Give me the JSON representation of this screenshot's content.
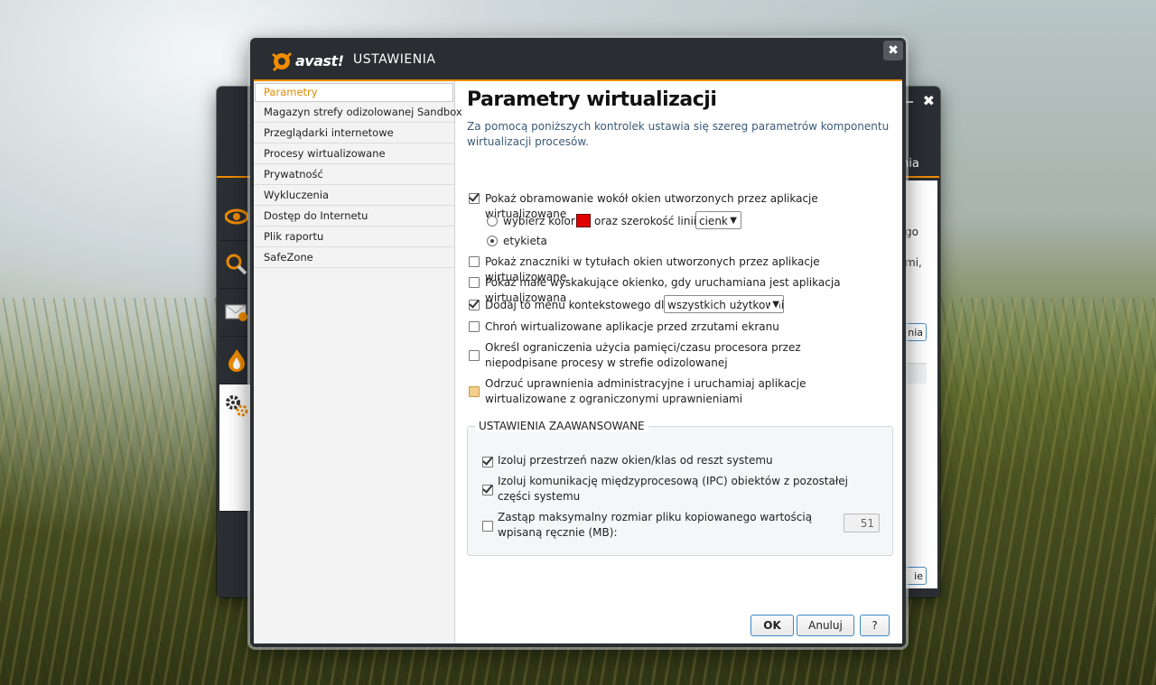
{
  "dialog": {
    "brand": "avast!",
    "title": "USTAWIENIA",
    "close_glyph": "✖"
  },
  "sidebar": {
    "items": [
      {
        "label": "Parametry",
        "active": true
      },
      {
        "label": "Magazyn strefy odizolowanej Sandbox"
      },
      {
        "label": "Przeglądarki internetowe"
      },
      {
        "label": "Procesy wirtualizowane"
      },
      {
        "label": "Prywatność"
      },
      {
        "label": "Wykluczenia"
      },
      {
        "label": "Dostęp do Internetu"
      },
      {
        "label": "Plik raportu"
      },
      {
        "label": "SafeZone"
      }
    ]
  },
  "main": {
    "title": "Parametry wirtualizacji",
    "description": "Za pomocą poniższych kontrolek ustawia się szereg parametrów komponentu wirtualizacji procesów.",
    "options": {
      "show_border": {
        "label": "Pokaż obramowanie wokół okien utworzonych przez aplikacje wirtualizowane",
        "checked": true
      },
      "choose_color": {
        "label": "wybierz kolor",
        "checked": false
      },
      "line_width_label": "oraz szerokość linii",
      "line_width_value": "cienk",
      "label_option": {
        "label": "etykieta",
        "checked": true
      },
      "title_markers": {
        "label": "Pokaż znaczniki w tytułach okien utworzonych przez aplikacje wirtualizowane",
        "checked": false
      },
      "popup": {
        "label": "Pokaż małe wyskakujące okienko, gdy uruchamiana jest aplikacja wirtualizowana",
        "checked": false
      },
      "context_menu": {
        "label": "Dodaj to menu kontekstowego dla:",
        "checked": true
      },
      "context_menu_value": "wszystkich użytkowni",
      "screenshots": {
        "label": "Chroń wirtualizowane aplikacje przed zrzutami ekranu",
        "checked": false
      },
      "limits": {
        "label": "Określ ograniczenia użycia pamięci/czasu procesora przez niepodpisane procesy w strefie odizolowanej",
        "checked": false
      },
      "drop_admin": {
        "label": "Odrzuć uprawnienia administracyjne i uruchamiaj aplikacje wirtualizowane z ograniczonymi uprawnieniami",
        "checked": "partial"
      }
    },
    "color_swatch": "#e00000",
    "advanced": {
      "legend": "USTAWIENIA ZAAWANSOWANE",
      "isolate_namespace": {
        "label": "Izoluj przestrzeń nazw okien/klas od reszt systemu",
        "checked": true
      },
      "isolate_ipc": {
        "label": "Izoluj komunikację międzyprocesową (IPC) obiektów z pozostałej części systemu",
        "checked": true
      },
      "max_file_size": {
        "label": "Zastąp maksymalny rozmiar pliku kopiowanego wartością wpisaną ręcznie (MB):",
        "checked": false,
        "value": "51"
      }
    }
  },
  "buttons": {
    "ok": "OK",
    "cancel": "Anuluj",
    "help": "?"
  },
  "background_window": {
    "tab_partial": "nia",
    "text_1": "go",
    "text_2": "mi,",
    "btn_1": "nia",
    "btn_2": "ie",
    "close_glyph": "✖"
  },
  "colors": {
    "accent": "#f08c00",
    "frame": "#2a2d31",
    "active_nav": "#e08a00",
    "button_border": "#3a87c8"
  }
}
